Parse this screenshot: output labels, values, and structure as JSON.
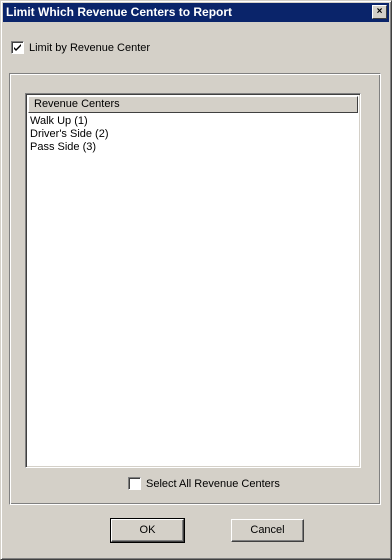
{
  "window": {
    "title": "Limit Which Revenue Centers to Report",
    "close_glyph": "×"
  },
  "limit_checkbox": {
    "label": "Limit by Revenue Center",
    "checked": true
  },
  "list": {
    "column_header": "Revenue Centers",
    "items": [
      {
        "label": "Walk Up (1)"
      },
      {
        "label": "Driver's Side (2)"
      },
      {
        "label": "Pass Side (3)"
      }
    ]
  },
  "select_all_checkbox": {
    "label": "Select All Revenue Centers",
    "checked": false
  },
  "buttons": {
    "ok_label": "OK",
    "cancel_label": "Cancel"
  },
  "colors": {
    "titlebar": "#0a246a",
    "face": "#d4d0c8"
  }
}
